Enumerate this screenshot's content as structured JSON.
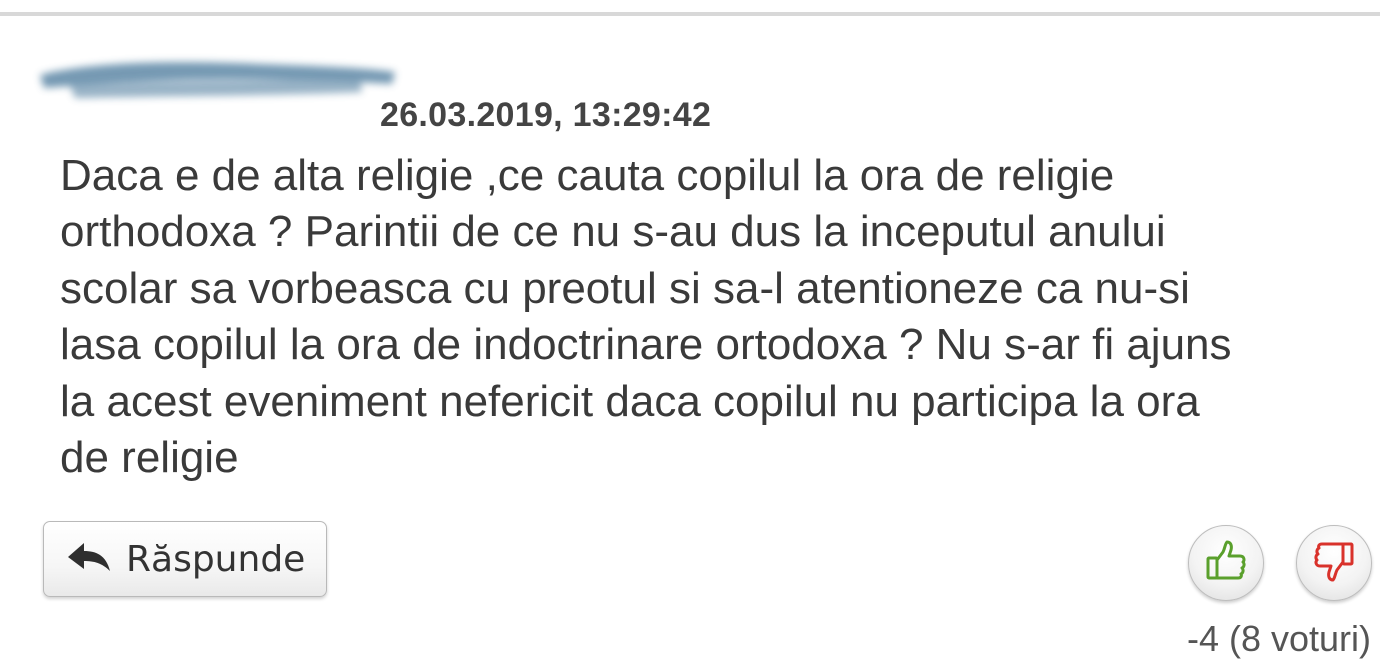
{
  "comment": {
    "author_redacted": true,
    "timestamp": "26.03.2019, 13:29:42",
    "text": "Daca e de alta religie ,ce cauta copilul la ora de religie\northodoxa ? Parintii de ce nu s-au dus la inceputul anului\nscolar sa vorbeasca cu preotul si sa-l atentioneze ca nu-si\nlasa copilul la ora de indoctrinare ortodoxa ? Nu s-ar fi ajuns\nla acest eveniment nefericit daca copilul nu participa la ora\nde religie"
  },
  "actions": {
    "reply_label": "Răspunde",
    "reply_icon": "reply-arrow-icon",
    "upvote_icon": "thumbs-up-icon",
    "downvote_icon": "thumbs-down-icon"
  },
  "votes": {
    "summary": "-4 (8 voturi)"
  },
  "colors": {
    "upvote_green": "#5aa02c",
    "downvote_red": "#d9322b"
  }
}
